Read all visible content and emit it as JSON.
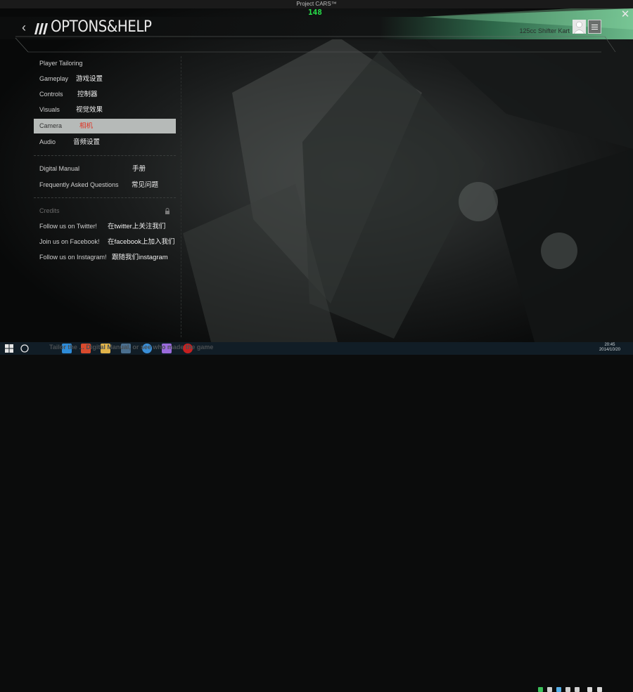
{
  "window": {
    "title": "Project CARS™",
    "fps": "148"
  },
  "header": {
    "title": "OPTONS&HELP",
    "vehicle": "125cc Shifter Kart"
  },
  "menu": {
    "section1": [
      {
        "en": "Player Tailoring",
        "zh": ""
      },
      {
        "en": "Gameplay",
        "zh": "游戏设置"
      },
      {
        "en": "Controls",
        "zh": "控制器"
      },
      {
        "en": "Visuals",
        "zh": "视觉效果"
      },
      {
        "en": "Camera",
        "zh": "相机",
        "selected": true
      },
      {
        "en": "Audio",
        "zh": "音频设置"
      }
    ],
    "section2": [
      {
        "en": "Digital Manual",
        "zh": "手册"
      },
      {
        "en": "Frequently Asked Questions",
        "zh": "常见问题"
      }
    ],
    "section3": [
      {
        "en": "Credits",
        "zh": "",
        "disabled": true
      },
      {
        "en": "Follow us on Twitter!",
        "zh": "在twitter上关注我们"
      },
      {
        "en": "Join us on Facebook!",
        "zh": "在facebook上加入我们"
      },
      {
        "en": "Follow us on Instagram!",
        "zh": "跟随我们instagram"
      }
    ]
  },
  "status_bar": {
    "text": "Tailor the  ... Digital Manual, or see who made the game"
  },
  "taskbar": {
    "time": "20:45",
    "date": "2014/10/20"
  },
  "colors": {
    "accent_green": "#3fa070",
    "selected_bg": "#b6bab8",
    "selected_zh": "#e03020"
  }
}
